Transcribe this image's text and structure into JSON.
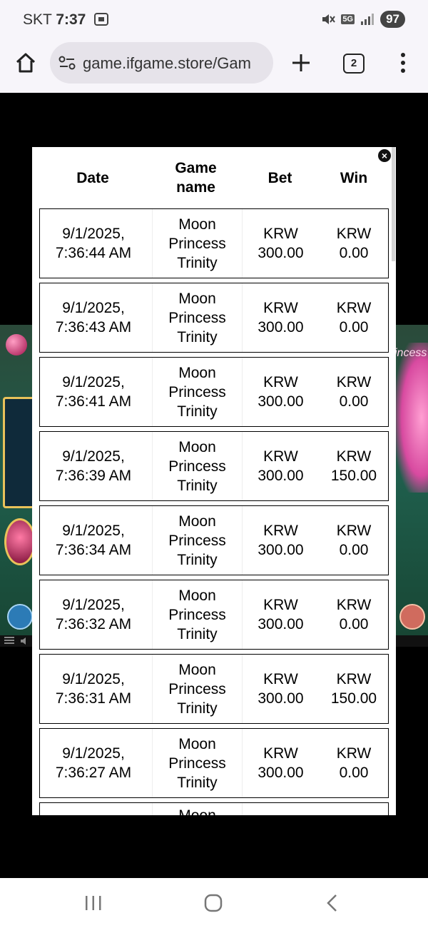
{
  "status_bar": {
    "carrier": "SKT",
    "time": "7:37",
    "network": "5G",
    "battery": "97"
  },
  "browser": {
    "url": "game.ifgame.store/Gam",
    "tab_count": "2"
  },
  "game_background": {
    "title_fragment": "incess"
  },
  "history": {
    "headers": {
      "date": "Date",
      "game_line1": "Game",
      "game_line2": "name",
      "bet": "Bet",
      "win": "Win"
    },
    "rows": [
      {
        "date1": "9/1/2025,",
        "date2": "7:36:44 AM",
        "g1": "Moon",
        "g2": "Princess",
        "g3": "Trinity",
        "bet_cur": "KRW",
        "bet_amt": "300.00",
        "win_cur": "KRW",
        "win_amt": "0.00"
      },
      {
        "date1": "9/1/2025,",
        "date2": "7:36:43 AM",
        "g1": "Moon",
        "g2": "Princess",
        "g3": "Trinity",
        "bet_cur": "KRW",
        "bet_amt": "300.00",
        "win_cur": "KRW",
        "win_amt": "0.00"
      },
      {
        "date1": "9/1/2025,",
        "date2": "7:36:41 AM",
        "g1": "Moon",
        "g2": "Princess",
        "g3": "Trinity",
        "bet_cur": "KRW",
        "bet_amt": "300.00",
        "win_cur": "KRW",
        "win_amt": "0.00"
      },
      {
        "date1": "9/1/2025,",
        "date2": "7:36:39 AM",
        "g1": "Moon",
        "g2": "Princess",
        "g3": "Trinity",
        "bet_cur": "KRW",
        "bet_amt": "300.00",
        "win_cur": "KRW",
        "win_amt": "150.00"
      },
      {
        "date1": "9/1/2025,",
        "date2": "7:36:34 AM",
        "g1": "Moon",
        "g2": "Princess",
        "g3": "Trinity",
        "bet_cur": "KRW",
        "bet_amt": "300.00",
        "win_cur": "KRW",
        "win_amt": "0.00"
      },
      {
        "date1": "9/1/2025,",
        "date2": "7:36:32 AM",
        "g1": "Moon",
        "g2": "Princess",
        "g3": "Trinity",
        "bet_cur": "KRW",
        "bet_amt": "300.00",
        "win_cur": "KRW",
        "win_amt": "0.00"
      },
      {
        "date1": "9/1/2025,",
        "date2": "7:36:31 AM",
        "g1": "Moon",
        "g2": "Princess",
        "g3": "Trinity",
        "bet_cur": "KRW",
        "bet_amt": "300.00",
        "win_cur": "KRW",
        "win_amt": "150.00"
      },
      {
        "date1": "9/1/2025,",
        "date2": "7:36:27 AM",
        "g1": "Moon",
        "g2": "Princess",
        "g3": "Trinity",
        "bet_cur": "KRW",
        "bet_amt": "300.00",
        "win_cur": "KRW",
        "win_amt": "0.00"
      },
      {
        "date1": "",
        "date2": "",
        "g1": "Moon",
        "g2": "",
        "g3": "",
        "bet_cur": "",
        "bet_amt": "",
        "win_cur": "",
        "win_amt": ""
      }
    ]
  }
}
